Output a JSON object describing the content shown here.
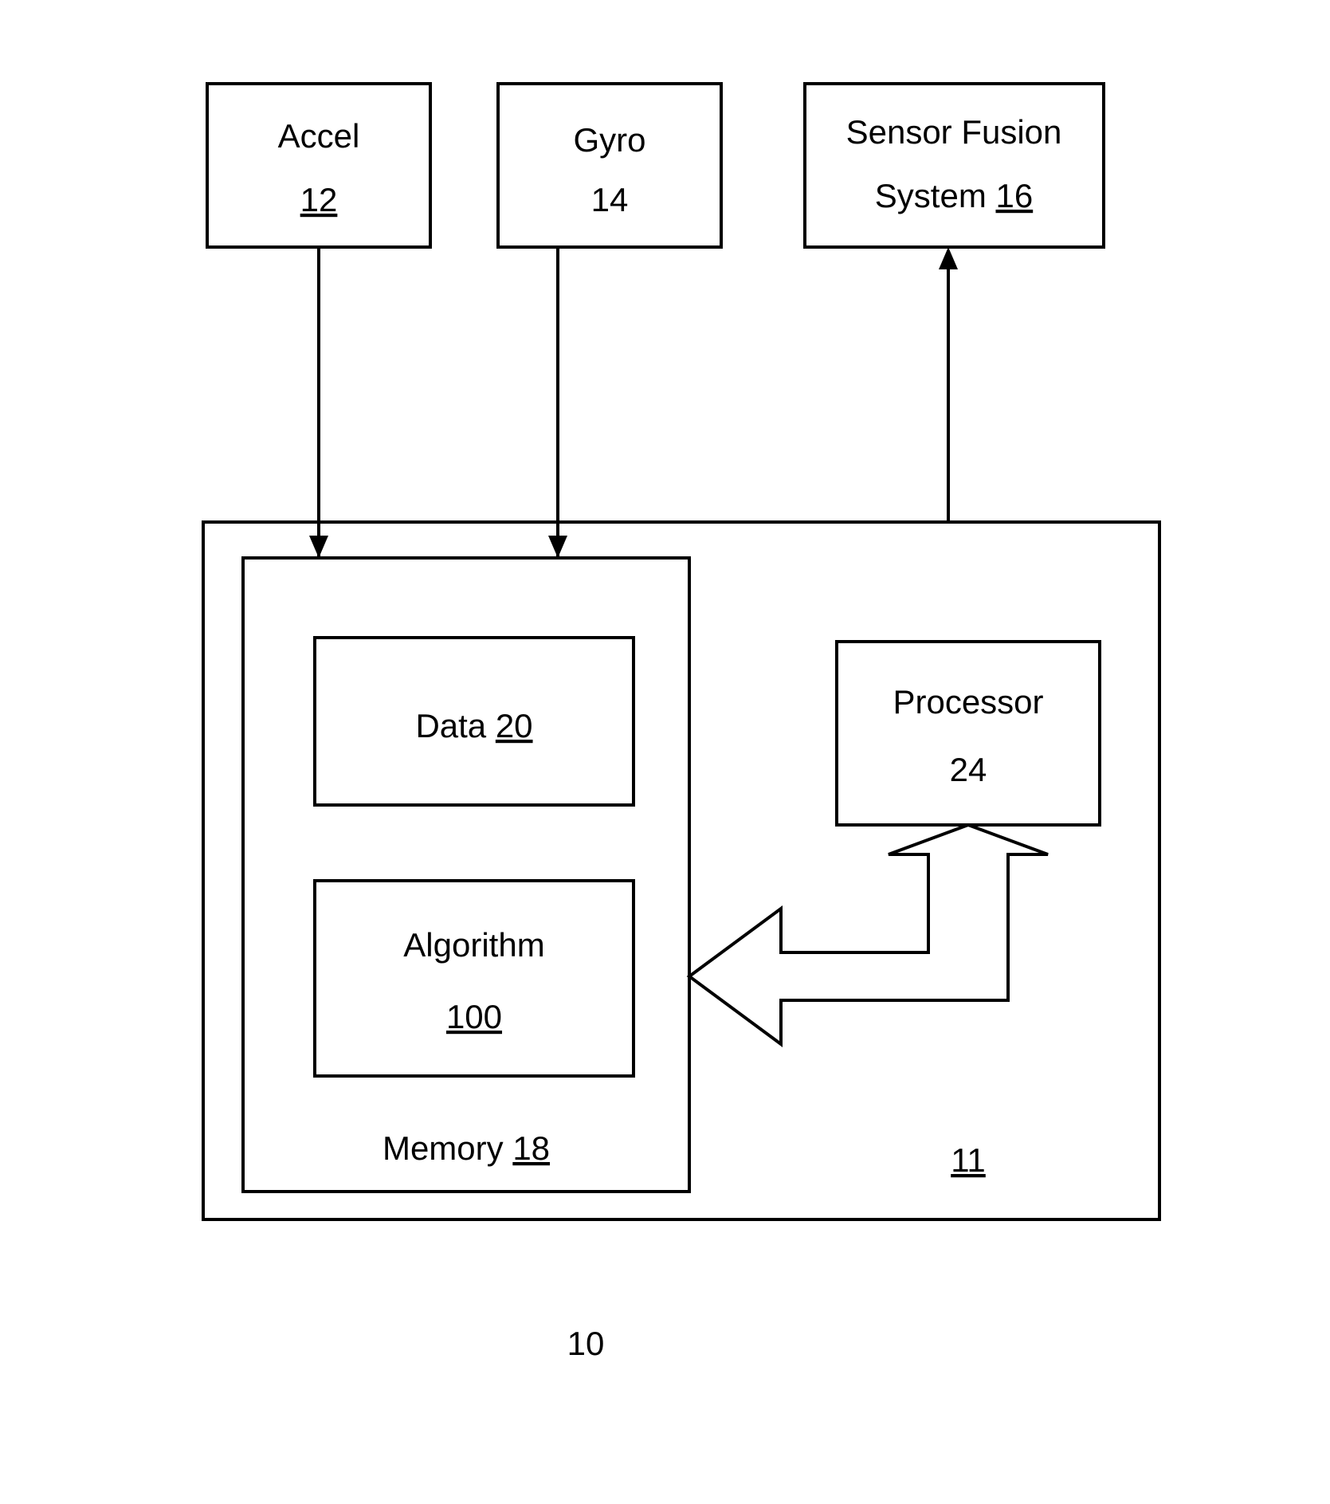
{
  "accel": {
    "label": "Accel",
    "ref": "12"
  },
  "gyro": {
    "label": "Gyro",
    "ref": "14"
  },
  "sensor_fusion": {
    "line1": "Sensor Fusion",
    "line2_prefix": "System",
    "ref": "16"
  },
  "data_box": {
    "label": "Data",
    "ref": "20"
  },
  "algorithm_box": {
    "label": "Algorithm",
    "ref": "100"
  },
  "memory": {
    "label": "Memory",
    "ref": "18"
  },
  "processor": {
    "label": "Processor",
    "ref": "24"
  },
  "outer": {
    "ref": "11"
  },
  "figure_number": "10"
}
